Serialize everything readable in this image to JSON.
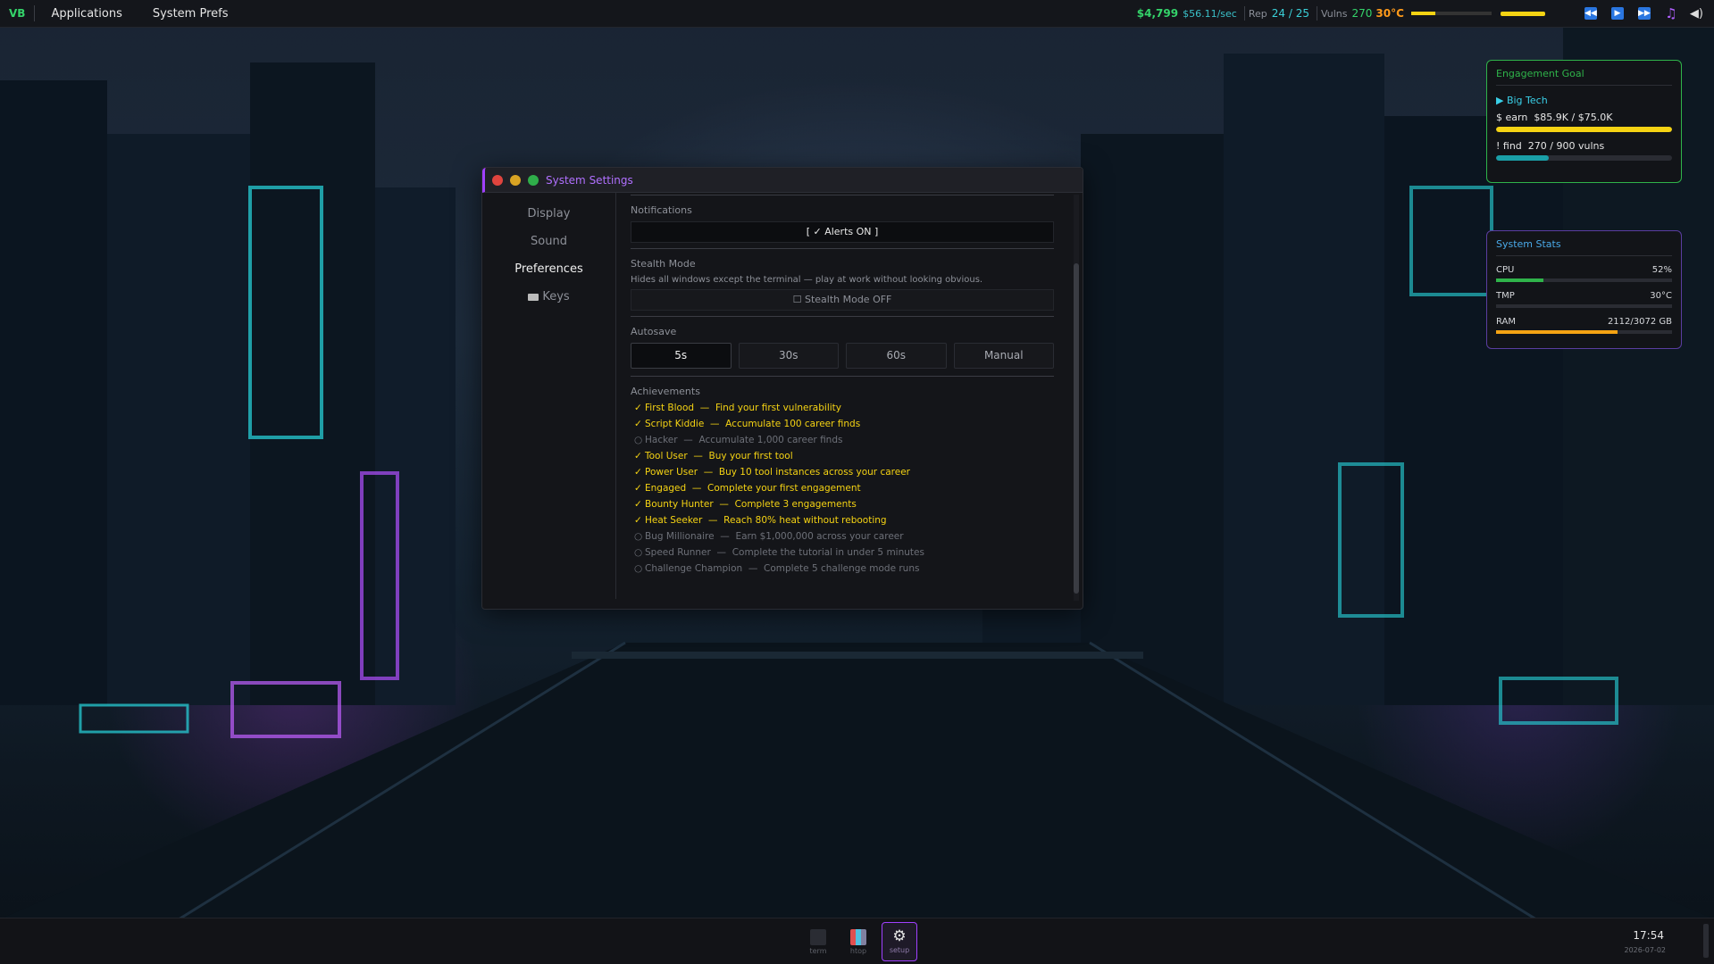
{
  "topbar": {
    "logo": "VB",
    "menu": [
      "Applications",
      "System Prefs"
    ],
    "money": "$4,799",
    "rate": "$56.11/sec",
    "rep_label": "Rep",
    "rep_value": "24 / 25",
    "vulns_label": "Vulns",
    "vulns_value": "270",
    "temp": "30°C",
    "heat_level": 0.3
  },
  "window": {
    "title": "System Settings",
    "sidebar": [
      {
        "label": "Display",
        "active": false
      },
      {
        "label": "Sound",
        "active": false
      },
      {
        "label": "Preferences",
        "active": true
      },
      {
        "label": "Keys",
        "active": false
      }
    ],
    "notifications": {
      "title": "Notifications",
      "button": "[ ✓ Alerts ON ]"
    },
    "stealth": {
      "title": "Stealth Mode",
      "desc": "Hides all windows except the terminal — play at work without looking obvious.",
      "button": "☐ Stealth Mode OFF"
    },
    "autosave": {
      "title": "Autosave",
      "options": [
        "5s",
        "30s",
        "60s",
        "Manual"
      ],
      "selected": "5s"
    },
    "achievements": {
      "title": "Achievements",
      "items": [
        {
          "name": "First Blood",
          "desc": "Find your first vulnerability",
          "done": true
        },
        {
          "name": "Script Kiddie",
          "desc": "Accumulate 100 career finds",
          "done": true
        },
        {
          "name": "Hacker",
          "desc": "Accumulate 1,000 career finds",
          "done": false
        },
        {
          "name": "Tool User",
          "desc": "Buy your first tool",
          "done": true
        },
        {
          "name": "Power User",
          "desc": "Buy 10 tool instances across your career",
          "done": true
        },
        {
          "name": "Engaged",
          "desc": "Complete your first engagement",
          "done": true
        },
        {
          "name": "Bounty Hunter",
          "desc": "Complete 3 engagements",
          "done": true
        },
        {
          "name": "Heat Seeker",
          "desc": "Reach 80% heat without rebooting",
          "done": true
        },
        {
          "name": "Bug Millionaire",
          "desc": "Earn $1,000,000 across your career",
          "done": false
        },
        {
          "name": "Speed Runner",
          "desc": "Complete the tutorial in under 5 minutes",
          "done": false
        },
        {
          "name": "Challenge Champion",
          "desc": "Complete 5 challenge mode runs",
          "done": false
        }
      ]
    }
  },
  "goal_widget": {
    "title": "Engagement Goal",
    "target": "▶ Big Tech",
    "earn_label": "$  earn",
    "earn_value": "$85.9K / $75.0K",
    "earn_progress": 1.0,
    "find_label": "!  find",
    "find_value": "270 / 900 vulns",
    "find_progress": 0.3,
    "earn_color": "#f5d313",
    "find_color": "#1aa0a8"
  },
  "stats_widget": {
    "title": "System Stats",
    "rows": [
      {
        "label": "CPU",
        "value": "52%",
        "fraction": 0.27,
        "color": "#2fb34a"
      },
      {
        "label": "TMP",
        "value": "30°C",
        "fraction": 0.0,
        "color": "#f5a313"
      },
      {
        "label": "RAM",
        "value": "2112/3072 GB",
        "fraction": 0.69,
        "color": "#f5a313"
      }
    ]
  },
  "taskbar": {
    "apps": [
      {
        "label": "term",
        "icon": "terminal-icon",
        "active": false
      },
      {
        "label": "htop",
        "icon": "chart-icon",
        "active": false
      },
      {
        "label": "setup",
        "icon": "gear-icon",
        "active": true
      }
    ],
    "clock": "17:54",
    "date": "2026-07-02"
  }
}
